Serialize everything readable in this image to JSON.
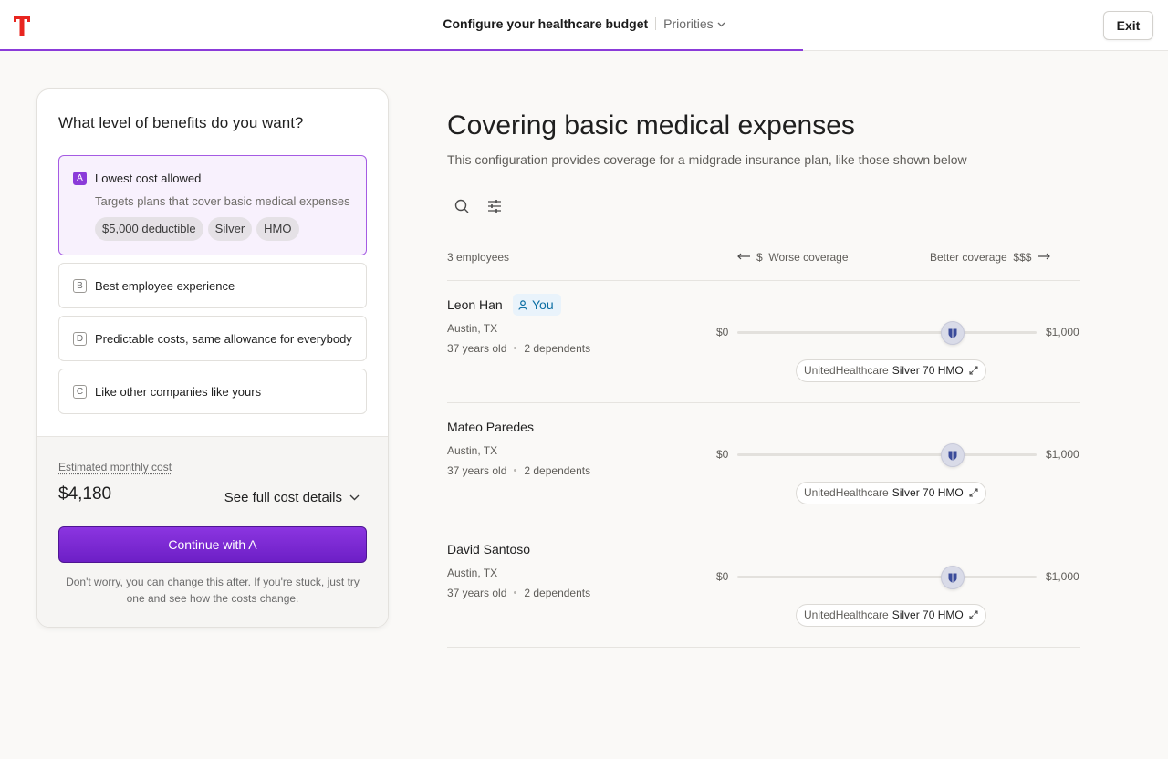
{
  "header": {
    "title": "Configure your healthcare budget",
    "section": "Priorities",
    "exit_label": "Exit",
    "progress_percent": 68.75
  },
  "card": {
    "question": "What level of benefits do you want?",
    "options": [
      {
        "letter": "A",
        "label": "Lowest cost allowed",
        "description": "Targets plans that cover basic medical expenses",
        "chips": [
          "$5,000 deductible",
          "Silver",
          "HMO"
        ],
        "selected": true
      },
      {
        "letter": "B",
        "label": "Best employee experience"
      },
      {
        "letter": "D",
        "label": "Predictable costs, same allowance for everybody"
      },
      {
        "letter": "C",
        "label": "Like other companies like yours"
      }
    ],
    "estimated_label": "Estimated monthly cost",
    "estimated_value": "$4,180",
    "cost_details_label": "See full cost details",
    "continue_label": "Continue with A",
    "hint": "Don't worry, you can change this after. If you're stuck, just try one and see how the costs change."
  },
  "main": {
    "title": "Covering basic medical expenses",
    "subtitle": "This configuration provides coverage for a midgrade insurance plan, like those shown below",
    "employee_count": "3 employees",
    "worse_label": "Worse coverage",
    "worse_symbol": "$",
    "better_label": "Better coverage",
    "better_symbol": "$$$",
    "slider_min": "$0",
    "slider_max": "$1,000",
    "you_label": "You",
    "employees": [
      {
        "name": "Leon Han",
        "is_you": true,
        "location": "Austin, TX",
        "age": "37 years old",
        "dependents": "2 dependents",
        "carrier": "UnitedHealthcare",
        "plan": "Silver 70 HMO",
        "slider_fraction": 0.72
      },
      {
        "name": "Mateo Paredes",
        "location": "Austin, TX",
        "age": "37 years old",
        "dependents": "2 dependents",
        "carrier": "UnitedHealthcare",
        "plan": "Silver 70 HMO",
        "slider_fraction": 0.72
      },
      {
        "name": "David Santoso",
        "location": "Austin, TX",
        "age": "37 years old",
        "dependents": "2 dependents",
        "carrier": "UnitedHealthcare",
        "plan": "Silver 70 HMO",
        "slider_fraction": 0.72
      }
    ]
  },
  "colors": {
    "accent": "#8b3bd9",
    "you_badge_bg": "#e9f3fb",
    "you_badge_text": "#0b6ea3",
    "logo": "#e8251f"
  },
  "icons": {
    "logo": "brand-t-logo",
    "search": "search-icon",
    "filter": "sliders-icon",
    "expand": "expand-icon",
    "user": "user-icon",
    "carrier": "shield-icon"
  }
}
